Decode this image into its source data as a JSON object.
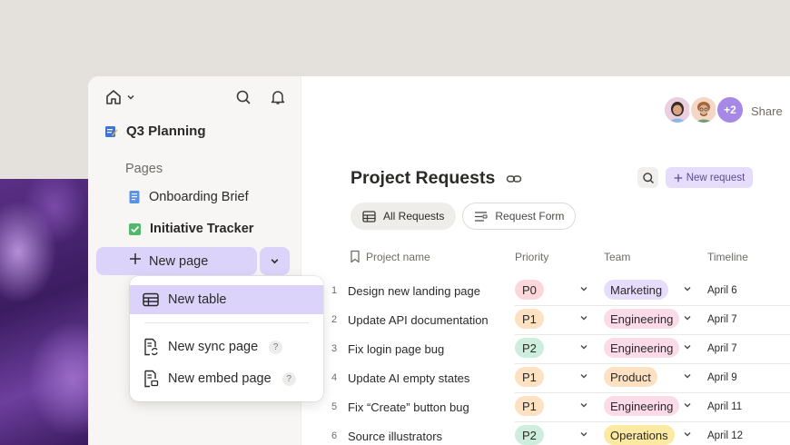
{
  "sidebar": {
    "workspace": "Q3 Planning",
    "pages_label": "Pages",
    "items": [
      {
        "label": "Onboarding Brief"
      },
      {
        "label": "Initiative Tracker"
      }
    ],
    "new_page_label": "New page"
  },
  "dropdown": {
    "items": [
      {
        "label": "New table"
      },
      {
        "label": "New sync page",
        "help": "?"
      },
      {
        "label": "New embed page",
        "help": "?"
      }
    ]
  },
  "header": {
    "avatar_more": "+2",
    "share": "Share"
  },
  "main": {
    "title": "Project Requests",
    "new_request": "New request",
    "views": [
      {
        "label": "All Requests",
        "active": true
      },
      {
        "label": "Request Form",
        "active": false
      }
    ]
  },
  "table": {
    "columns": [
      "Project name",
      "Priority",
      "Team",
      "Timeline"
    ],
    "rows": [
      {
        "num": "1",
        "name": "Design new landing page",
        "priority": "P0",
        "team": "Marketing",
        "timeline": "April 6"
      },
      {
        "num": "2",
        "name": "Update API documentation",
        "priority": "P1",
        "team": "Engineering",
        "timeline": "April 7"
      },
      {
        "num": "3",
        "name": "Fix login page bug",
        "priority": "P2",
        "team": "Engineering",
        "timeline": "April 7"
      },
      {
        "num": "4",
        "name": "Update AI empty states",
        "priority": "P1",
        "team": "Product",
        "timeline": "April 9"
      },
      {
        "num": "5",
        "name": "Fix “Create” button bug",
        "priority": "P1",
        "team": "Engineering",
        "timeline": "April 11"
      },
      {
        "num": "6",
        "name": "Source illustrators",
        "priority": "P2",
        "team": "Operations",
        "timeline": "April 12"
      }
    ]
  },
  "colors": {
    "accent": "#dcd3fb",
    "sidebar_bg": "#f7f6f4",
    "desktop_bg": "#e4e1dc"
  }
}
